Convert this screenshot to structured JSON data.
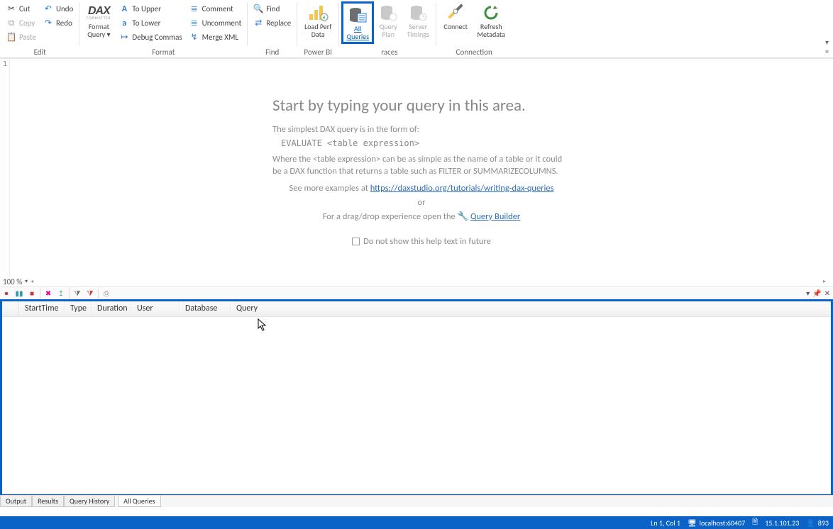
{
  "ribbon": {
    "clipboard": {
      "cut": "Cut",
      "copy": "Copy",
      "paste": "Paste",
      "undo": "Undo",
      "redo": "Redo",
      "group_label": "Edit"
    },
    "dax": {
      "label1": "Format",
      "label2": "Query",
      "tri": "▾"
    },
    "format": {
      "to_upper": "To Upper",
      "to_lower": "To Lower",
      "debug_commas": "Debug Commas",
      "comment": "Comment",
      "uncomment": "Uncomment",
      "merge_xml": "Merge XML",
      "group_label": "Format"
    },
    "find": {
      "find": "Find",
      "replace": "Replace",
      "group_label": "Find"
    },
    "powerbi": {
      "load_perf1": "Load Perf",
      "load_perf2": "Data",
      "group_label": "Power BI"
    },
    "traces": {
      "all_queries1": "All",
      "all_queries2": "Queries",
      "query_plan1": "Query",
      "query_plan2": "Plan",
      "server_timings1": "Server",
      "server_timings2": "Timings",
      "group_label": "races"
    },
    "connection": {
      "connect": "Connect",
      "refresh1": "Refresh",
      "refresh2": "Metadata",
      "group_label": "Connection"
    }
  },
  "editor": {
    "line_number": "1",
    "hint_title": "Start by typing your query in this area.",
    "hint_p1": "The simplest DAX query is in the form of:",
    "hint_code": "EVALUATE <table expression>",
    "hint_p2": "Where the <table expression> can be as simple as the name of a table or it could be a DAX function that returns a table such as FILTER or SUMMARIZECOLUMNS.",
    "hint_p3a": "See more examples at ",
    "hint_link": "https://daxstudio.org/tutorials/writing-dax-queries",
    "hint_or": "or",
    "hint_p4a": "For a drag/drop experience open the ",
    "hint_qb": "Query Builder",
    "hint_cb": "Do not show this help text in future",
    "zoom": "100 %",
    "zoom_tri": "▾"
  },
  "grid": {
    "columns": [
      "StartTime",
      "Type",
      "Duration",
      "User",
      "Database",
      "Query"
    ]
  },
  "tabs": {
    "output": "Output",
    "results": "Results",
    "query_history": "Query History",
    "all_queries": "All Queries"
  },
  "status": {
    "ln_col": "Ln 1, Col 1",
    "host": "localhost:60407",
    "version": "15.1.101.23",
    "users": "893"
  }
}
